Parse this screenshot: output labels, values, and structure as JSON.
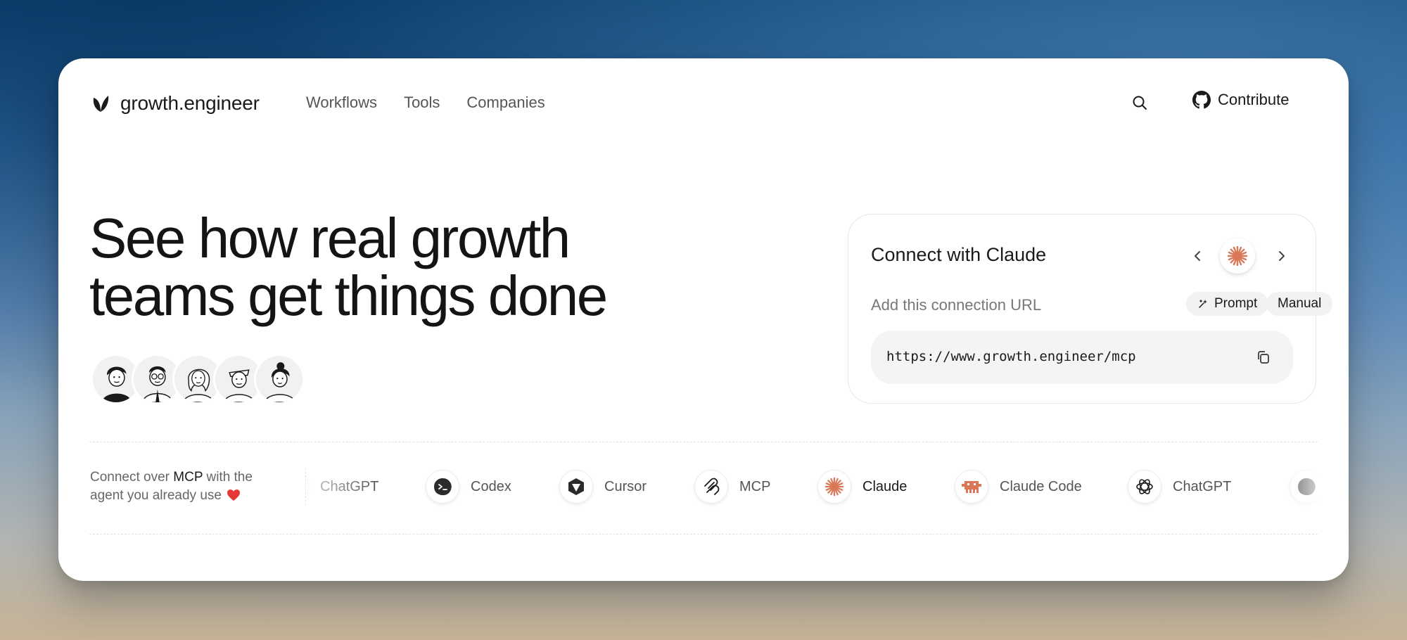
{
  "brand": {
    "name": "growth.engineer"
  },
  "nav": {
    "items": [
      "Workflows",
      "Tools",
      "Companies"
    ]
  },
  "header": {
    "search_icon": "search-icon",
    "contribute_label": "Contribute",
    "contribute_icon": "github-icon"
  },
  "hero": {
    "title_line1": "See how real growth",
    "title_line2": "teams get things done",
    "avatar_count": 5
  },
  "connect": {
    "title": "Connect with Claude",
    "subtitle": "Add this connection URL",
    "prompt_label": "Prompt",
    "manual_label": "Manual",
    "url": "https://www.growth.engineer/mcp",
    "accent_color": "#d97757"
  },
  "strip": {
    "text_prefix": "Connect over ",
    "text_mcp": "MCP",
    "text_suffix": " with the agent you already use",
    "heart_color": "#e53935",
    "tools": [
      {
        "label": "ChatGPT",
        "icon": "openai-icon"
      },
      {
        "label": "Codex",
        "icon": "codex-icon"
      },
      {
        "label": "Cursor",
        "icon": "cursor-icon"
      },
      {
        "label": "MCP",
        "icon": "mcp-icon"
      },
      {
        "label": "Claude",
        "icon": "claude-icon"
      },
      {
        "label": "Claude Code",
        "icon": "claude-code-icon"
      },
      {
        "label": "ChatGPT",
        "icon": "openai-icon"
      }
    ]
  }
}
